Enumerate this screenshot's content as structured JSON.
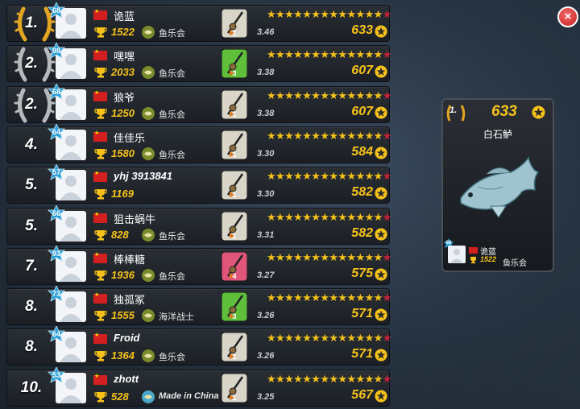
{
  "rows": [
    {
      "rank": "1.",
      "medal": "gold",
      "level": "68",
      "name": "诡蓝",
      "name_italic": false,
      "score": "1522",
      "club": "鱼乐会",
      "club_italic": false,
      "club_icon": "fish-club-icon",
      "rod_color": "#d9d5c9",
      "rod_num": "1",
      "ratio": "3.46",
      "points": "633"
    },
    {
      "rank": "2.",
      "medal": "silver",
      "level": "98",
      "name": "嘿嘿",
      "name_italic": false,
      "score": "2033",
      "club": "鱼乐会",
      "club_italic": false,
      "club_icon": "fish-club-icon",
      "rod_color": "#5fbf3b",
      "rod_num": "3",
      "ratio": "3.38",
      "points": "607"
    },
    {
      "rank": "2.",
      "medal": "silver",
      "level": "68",
      "name": "狼爷",
      "name_italic": false,
      "score": "1250",
      "club": "鱼乐会",
      "club_italic": false,
      "club_icon": "fish-club-icon",
      "rod_color": "#d9d5c9",
      "rod_num": "1",
      "ratio": "3.38",
      "points": "607"
    },
    {
      "rank": "4.",
      "medal": "none",
      "level": "64",
      "name": "佳佳乐",
      "name_italic": false,
      "score": "1580",
      "club": "鱼乐会",
      "club_italic": false,
      "club_icon": "fish-club-icon",
      "rod_color": "#d9d5c9",
      "rod_num": "1",
      "ratio": "3.30",
      "points": "584"
    },
    {
      "rank": "5.",
      "medal": "none",
      "level": "57",
      "name": "yhj 3913841",
      "name_italic": true,
      "score": "1169",
      "club": "",
      "club_italic": false,
      "club_icon": "",
      "rod_color": "#d9d5c9",
      "rod_num": "1",
      "ratio": "3.30",
      "points": "582"
    },
    {
      "rank": "5.",
      "medal": "none",
      "level": "66",
      "name": "狙击蜗牛",
      "name_italic": false,
      "score": "828",
      "club": "鱼乐会",
      "club_italic": false,
      "club_icon": "fish-club-icon",
      "rod_color": "#d9d5c9",
      "rod_num": "1",
      "ratio": "3.31",
      "points": "582"
    },
    {
      "rank": "7.",
      "medal": "none",
      "level": "93",
      "name": "棒棒糖",
      "name_italic": false,
      "score": "1936",
      "club": "鱼乐会",
      "club_italic": false,
      "club_icon": "fish-club-icon",
      "rod_color": "#e0557a",
      "rod_num": "4",
      "ratio": "3.27",
      "points": "575"
    },
    {
      "rank": "8.",
      "medal": "none",
      "level": "73",
      "name": "独孤冢",
      "name_italic": false,
      "score": "1555",
      "club": "海洋战士",
      "club_italic": false,
      "club_icon": "hook-club-icon",
      "rod_color": "#5fbf3b",
      "rod_num": "3",
      "ratio": "3.26",
      "points": "571"
    },
    {
      "rank": "8.",
      "medal": "none",
      "level": "64",
      "name": "Froid",
      "name_italic": true,
      "score": "1364",
      "club": "鱼乐会",
      "club_italic": false,
      "club_icon": "fish-club-icon",
      "rod_color": "#d9d5c9",
      "rod_num": "1",
      "ratio": "3.26",
      "points": "571"
    },
    {
      "rank": "10.",
      "medal": "none",
      "level": "53",
      "name": "zhott",
      "name_italic": true,
      "score": "528",
      "club": "Made in China",
      "club_italic": true,
      "club_icon": "globe-club-icon",
      "rod_color": "#d9d5c9",
      "rod_num": "1",
      "ratio": "3.25",
      "points": "567"
    }
  ],
  "card": {
    "rank": "1.",
    "points": "633",
    "fish_name": "白石鲈",
    "level": "68",
    "player": "诡蓝",
    "score": "1522",
    "club": "鱼乐会"
  },
  "close_label": "×",
  "colors": {
    "gold": "#f6c21a",
    "star_red": "#c7213a",
    "flag_red": "#d21f1f",
    "close_red": "#c91d1d"
  }
}
